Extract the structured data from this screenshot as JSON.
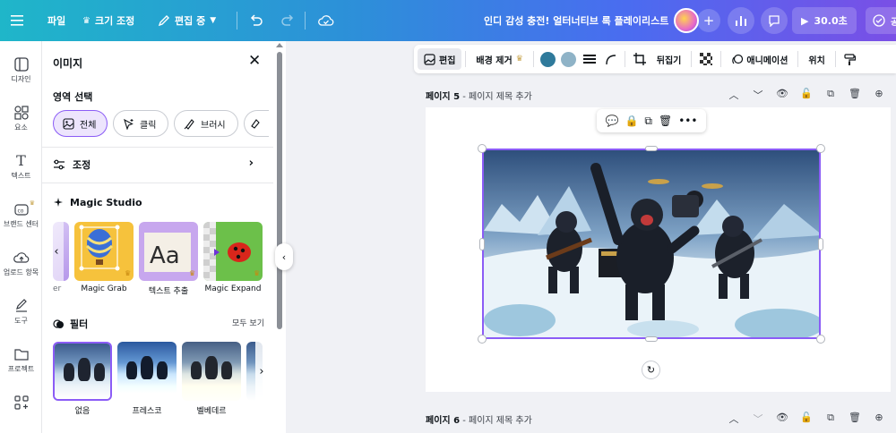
{
  "topbar": {
    "menu_icon": "hamburger-icon",
    "file_label": "파일",
    "resize_label": "크기 조정",
    "editing_label": "편집 중",
    "doc_title": "인디 감성 충전! 얼터너티브 록 플레이리스트",
    "play_label": "30.0초"
  },
  "rail": {
    "items": [
      {
        "label": "디자인",
        "icon": "layout-icon"
      },
      {
        "label": "요소",
        "icon": "elements-icon"
      },
      {
        "label": "텍스트",
        "icon": "text-icon"
      },
      {
        "label": "브랜드 센터",
        "icon": "brand-icon"
      },
      {
        "label": "업로드 항목",
        "icon": "upload-icon"
      },
      {
        "label": "도구",
        "icon": "draw-icon"
      },
      {
        "label": "프로젝트",
        "icon": "folder-icon"
      },
      {
        "label": "",
        "icon": "apps-icon"
      }
    ]
  },
  "panel": {
    "title": "이미지",
    "select_area": {
      "title": "영역 선택",
      "options": [
        "전체",
        "클릭",
        "브러시"
      ]
    },
    "adjust_label": "조정",
    "studio": {
      "title": "Magic Studio",
      "cards": [
        "er",
        "Magic Grab",
        "텍스트 추출",
        "Magic Expand"
      ]
    },
    "filters": {
      "title": "필터",
      "see_all": "모두 보기",
      "items": [
        "없음",
        "프레스코",
        "벨베데르"
      ]
    }
  },
  "toolbar": {
    "edit_label": "편집",
    "bg_remove_label": "배경 제거",
    "colors": [
      "#2f7a9b",
      "#8fb3c7"
    ],
    "flip_label": "뒤집기",
    "animate_label": "애니메이션",
    "position_label": "위치"
  },
  "pages": [
    {
      "title": "페이지 5",
      "add_title": "- 페이지 제목 추가"
    },
    {
      "title": "페이지 6",
      "add_title": "- 페이지 제목 추가"
    }
  ],
  "studio_card_letters": "Aa"
}
